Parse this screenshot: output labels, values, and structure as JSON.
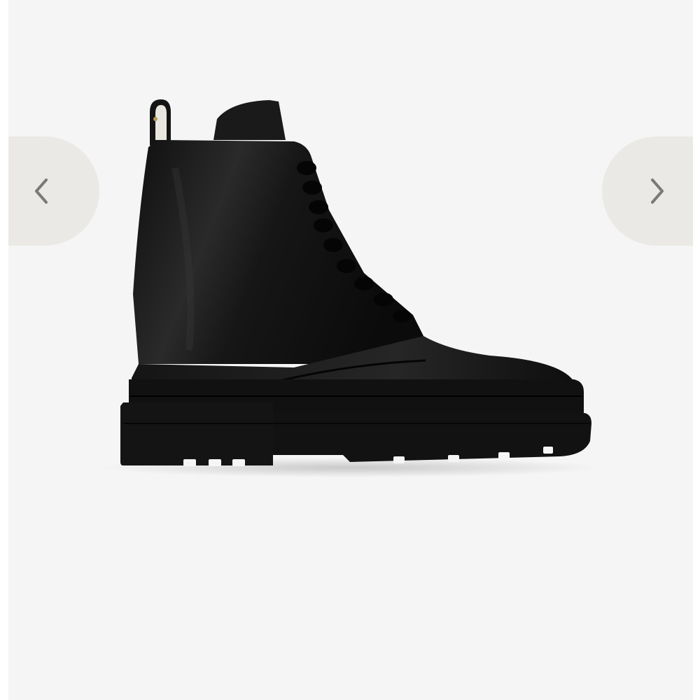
{
  "gallery": {
    "image": {
      "subject": "black-leather-lace-up-ankle-boot",
      "background_color": "#f5f5f5"
    },
    "prev_button": {
      "icon": "chevron-left-icon",
      "color": "#ebe9e5"
    },
    "next_button": {
      "icon": "chevron-right-icon",
      "color": "#ebe9e5"
    }
  }
}
